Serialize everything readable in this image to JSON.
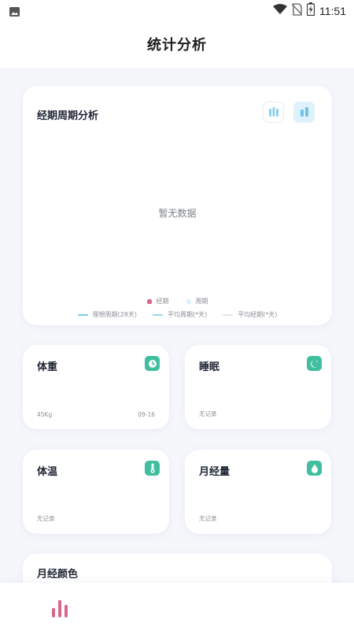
{
  "status_bar": {
    "time": "11:51",
    "icons": [
      "image-icon",
      "wifi-icon",
      "no-sim-icon",
      "battery-charging-icon"
    ]
  },
  "header": {
    "title": "统计分析"
  },
  "cycle_analysis": {
    "title": "经期周期分析",
    "view_buttons": [
      "bar-chart-icon",
      "stacked-bar-chart-icon"
    ],
    "empty_text": "暂无数据",
    "legend": [
      {
        "label": "经期",
        "color": "#d9678a"
      },
      {
        "label": "周期",
        "color": "#dff2fb"
      }
    ],
    "lines": [
      {
        "label": "理想周期(28天)",
        "color": "#7cc6e6"
      },
      {
        "label": "平均周期(*天)",
        "color": "#9ed3ee"
      },
      {
        "label": "平均经期(*天)",
        "color": "#e4e6ea"
      }
    ]
  },
  "cards": {
    "weight": {
      "title": "体重",
      "icon": "clock-icon",
      "value": "45Kg",
      "date": "09-16"
    },
    "sleep": {
      "title": "睡眠",
      "icon": "moon-icon",
      "value": "无记录"
    },
    "temperature": {
      "title": "体温",
      "icon": "thermometer-icon",
      "value": "无记录"
    },
    "flow": {
      "title": "月经量",
      "icon": "drop-icon",
      "value": "无记录"
    },
    "color": {
      "title": "月经颜色"
    }
  },
  "bottom_nav": {
    "active_icon": "stats-icon",
    "active_color": "#d9678a"
  },
  "colors": {
    "accent_green": "#3fbf9f",
    "accent_pink": "#d9678a",
    "accent_blue": "#dff2fb"
  }
}
